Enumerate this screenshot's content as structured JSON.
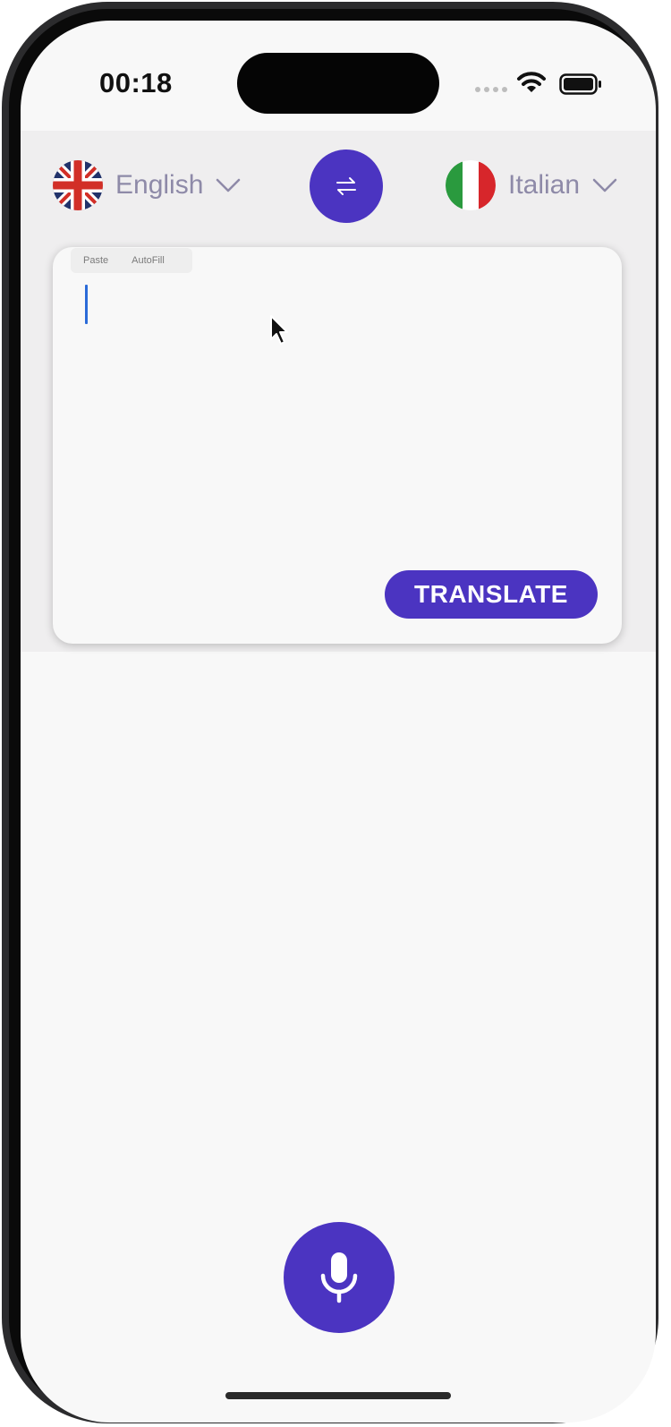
{
  "status_bar": {
    "time": "00:18",
    "signal_icon": "cellular-signal-icon",
    "wifi_icon": "wifi-icon",
    "battery_icon": "battery-icon"
  },
  "languages": {
    "source": {
      "label": "English",
      "flag_icon": "uk-flag-icon"
    },
    "target": {
      "label": "Italian",
      "flag_icon": "italy-flag-icon"
    },
    "swap_icon": "swap-arrows-icon"
  },
  "input_card": {
    "value": "",
    "edit_menu": {
      "paste_label": "Paste",
      "autofill_label": "AutoFill"
    },
    "translate_label": "TRANSLATE"
  },
  "mic": {
    "icon": "microphone-icon"
  },
  "colors": {
    "accent": "#4b34c1",
    "band_background": "#efeeef",
    "screen_background": "#f8f8f8",
    "language_text": "#8e8aa8",
    "caret": "#2b6bd8"
  }
}
